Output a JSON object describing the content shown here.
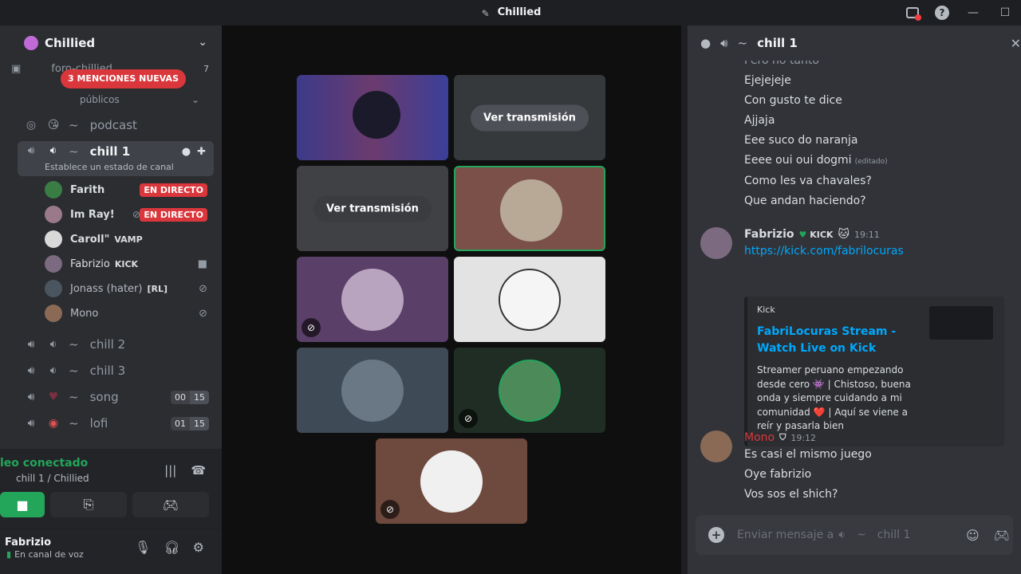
{
  "window": {
    "title": "Chillied"
  },
  "sidebar": {
    "server_name": "Chillied",
    "forum_channel": "foro-chillied",
    "forum_count": "7",
    "mentions_badge": "3 MENCIONES NUEVAS",
    "category": "públicos",
    "channels": [
      {
        "name": "podcast",
        "emoji": "😘"
      },
      {
        "name": "chill 1",
        "status_hint": "Establece un estado de canal"
      },
      {
        "name": "chill 2"
      },
      {
        "name": "chill 3"
      },
      {
        "name": "song",
        "count_a": "00",
        "count_b": "15"
      },
      {
        "name": "lofi",
        "count_a": "01",
        "count_b": "15"
      }
    ],
    "voice_users": [
      {
        "name": "Farith",
        "badge": "EN DIRECTO"
      },
      {
        "name": "Im Ray!",
        "badge": "EN DIRECTO"
      },
      {
        "name": "Caroll\"",
        "tag": "VAMP"
      },
      {
        "name": "Fabrizio",
        "tag": "KICK"
      },
      {
        "name": "Jonass (hater)",
        "tag": "[RL]"
      },
      {
        "name": "Mono"
      }
    ]
  },
  "voice_panel": {
    "status": "leo conectado",
    "location": "chill 1 / Chillied"
  },
  "user": {
    "name": "Fabrizio",
    "status": "En canal de voz"
  },
  "stage": {
    "watch_label": "Ver transmisión"
  },
  "chat": {
    "channel": "chill 1",
    "lines_top": [
      "Pero no tanto",
      "Ejejejeje",
      "Con gusto te dice",
      "Ajjaja",
      "Eee suco do naranja",
      "Eeee oui oui dogmi",
      "Como les va chavales?",
      "Que andan haciendo?"
    ],
    "edited_label": "(editado)",
    "msg1": {
      "author": "Fabrizio",
      "badge": "KICK",
      "time": "19:11",
      "link": "https://kick.com/fabrilocuras",
      "embed_provider": "Kick",
      "embed_title": "FabriLocuras Stream - Watch Live on Kick",
      "embed_desc": "Streamer peruano empezando desde cero 👾 | Chistoso, buena onda y siempre cuidando a mi comunidad ❤️ | Aquí se viene a reír y pasarla bien"
    },
    "msg2": {
      "author": "Mono",
      "time": "19:12",
      "lines": [
        "Es casi el mismo juego",
        "Oye fabrizio",
        "Vos sos el shich?"
      ]
    },
    "composer_placeholder": "Enviar mensaje a",
    "composer_channel": "chill 1"
  }
}
